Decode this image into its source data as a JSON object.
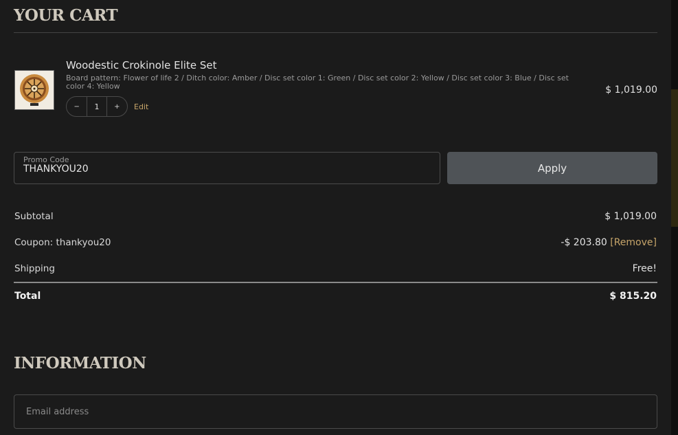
{
  "cart": {
    "title": "YOUR CART",
    "item": {
      "name": "Woodestic Crokinole Elite Set",
      "variant": "Board pattern: Flower of life 2 / Ditch color: Amber / Disc set color 1: Green / Disc set color 2: Yellow / Disc set color 3: Blue / Disc set color 4: Yellow",
      "price": "$ 1,019.00",
      "quantity": "1",
      "decrease_label": "−",
      "increase_label": "+",
      "edit_label": "Edit"
    }
  },
  "promo": {
    "label": "Promo Code",
    "value": "THANKYOU20",
    "apply_label": "Apply"
  },
  "summary": {
    "subtotal_label": "Subtotal",
    "subtotal_value": "$ 1,019.00",
    "coupon_label": "Coupon: thankyou20",
    "coupon_value": "-$ 203.80",
    "remove_label": "[Remove]",
    "shipping_label": "Shipping",
    "shipping_value": "Free!",
    "total_label": "Total",
    "total_value": "$ 815.20"
  },
  "information": {
    "title": "INFORMATION",
    "email_placeholder": "Email address"
  },
  "colors": {
    "background": "#1b1b1b",
    "accent": "#c7a56a",
    "button": "#4f5357"
  }
}
